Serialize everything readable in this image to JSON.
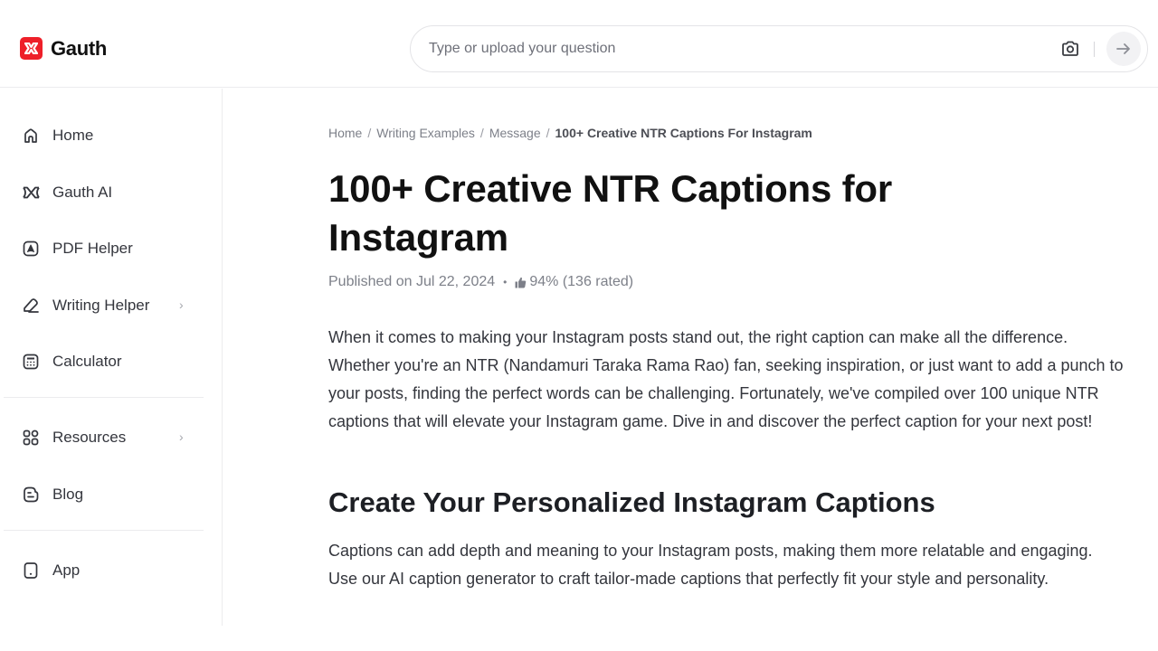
{
  "header": {
    "logo_text": "Gauth",
    "brand_color": "#ee1f29",
    "search": {
      "placeholder": "Type or upload your question",
      "value": "",
      "camera_icon": "camera-icon",
      "submit_icon": "arrow-right-icon"
    }
  },
  "sidebar": {
    "items": [
      {
        "label": "Home",
        "icon": "home-icon",
        "has_submenu": false
      },
      {
        "label": "Gauth AI",
        "icon": "gauth-ai-icon",
        "has_submenu": false
      },
      {
        "label": "PDF Helper",
        "icon": "pdf-icon",
        "has_submenu": false
      },
      {
        "label": "Writing Helper",
        "icon": "pen-icon",
        "has_submenu": true
      },
      {
        "label": "Calculator",
        "icon": "calculator-icon",
        "has_submenu": false
      },
      {
        "label": "Resources",
        "icon": "grid-icon",
        "has_submenu": true
      },
      {
        "label": "Blog",
        "icon": "blog-icon",
        "has_submenu": false
      },
      {
        "label": "App",
        "icon": "phone-icon",
        "has_submenu": false
      }
    ],
    "chevron": "›"
  },
  "breadcrumb": {
    "items": [
      "Home",
      "Writing Examples",
      "Message"
    ],
    "current": "100+ Creative NTR Captions For Instagram",
    "separator": "/"
  },
  "article": {
    "title": "100+ Creative NTR Captions for Instagram",
    "published": "Published on Jul 22, 2024",
    "dot": "•",
    "rating": "94% (136 rated)",
    "intro": "When it comes to making your Instagram posts stand out, the right caption can make all the difference. Whether you're an NTR (Nandamuri Taraka Rama Rao) fan, seeking inspiration, or just want to add a punch to your posts, finding the perfect words can be challenging. Fortunately, we've compiled over 100 unique NTR captions that will elevate your Instagram game. Dive in and discover the perfect caption for your next post!",
    "section_title": "Create Your Personalized Instagram Captions",
    "section_body": "Captions can add depth and meaning to your Instagram posts, making them more relatable and engaging. Use our AI caption generator to craft tailor-made captions that perfectly fit your style and personality."
  }
}
